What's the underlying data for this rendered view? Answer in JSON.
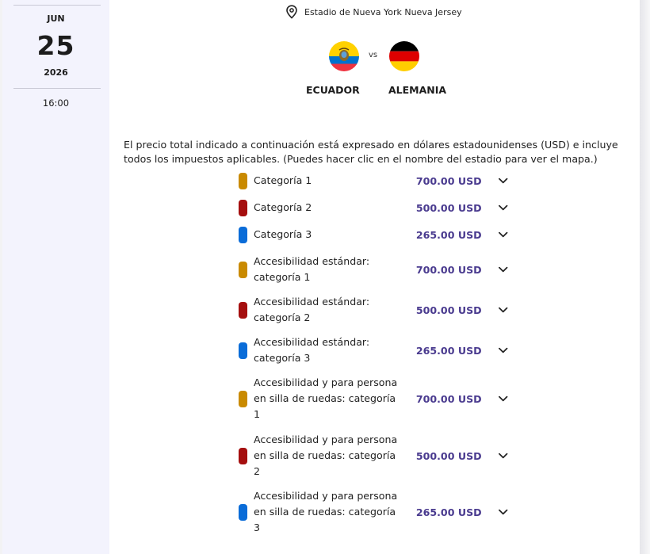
{
  "event": {
    "month": "JUN",
    "day": "25",
    "year": "2026",
    "time": "16:00",
    "venue": "Estadio de Nueva York Nueva Jersey",
    "vs_label": "vs",
    "home_team": "ECUADOR",
    "away_team": "ALEMANIA"
  },
  "info_text": "El precio total indicado a continuación está expresado en dólares estadounidenses (USD) e incluye todos los impuestos aplicables. (Puedes hacer clic en el nombre del estadio para ver el mapa.)",
  "categories": [
    {
      "label": "Categoría 1",
      "price": "700.00 USD",
      "color": "#c98a00"
    },
    {
      "label": "Categoría 2",
      "price": "500.00 USD",
      "color": "#a50f0f"
    },
    {
      "label": "Categoría 3",
      "price": "265.00 USD",
      "color": "#0a6cd8"
    },
    {
      "label": "Accesibilidad estándar: categoría 1",
      "price": "700.00 USD",
      "color": "#c98a00"
    },
    {
      "label": "Accesibilidad estándar: categoría 2",
      "price": "500.00 USD",
      "color": "#a50f0f"
    },
    {
      "label": "Accesibilidad estándar: categoría 3",
      "price": "265.00 USD",
      "color": "#0a6cd8"
    },
    {
      "label": "Accesibilidad y para persona en silla de ruedas: categoría 1",
      "price": "700.00 USD",
      "color": "#c98a00"
    },
    {
      "label": "Accesibilidad y para persona en silla de ruedas: categoría 2",
      "price": "500.00 USD",
      "color": "#a50f0f"
    },
    {
      "label": "Accesibilidad y para persona en silla de ruedas: categoría 3",
      "price": "265.00 USD",
      "color": "#0a6cd8"
    }
  ],
  "icons": {
    "venue": "map-pin-icon",
    "expand": "chevron-down-icon"
  }
}
